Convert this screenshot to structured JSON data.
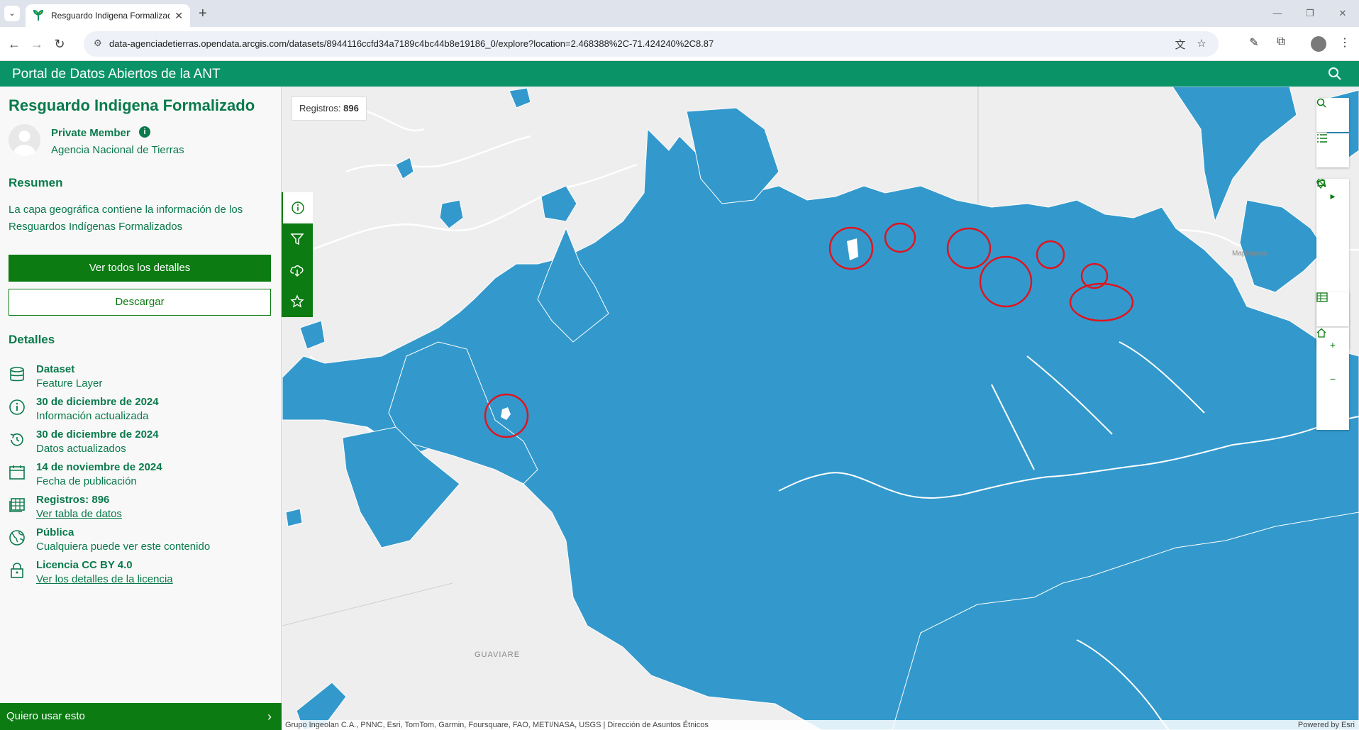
{
  "browser": {
    "tab_title": "Resguardo Indigena Formalizado",
    "url": "data-agenciadetierras.opendata.arcgis.com/datasets/8944116ccfd34a7189c4bc44b8e19186_0/explore?location=2.468388%2C-71.424240%2C8.87"
  },
  "site": {
    "title": "Portal de Datos Abiertos de la ANT",
    "brand_color": "#0a9366"
  },
  "sidebar": {
    "dataset_title": "Resguardo Indigena Formalizado",
    "owner_role": "Private Member",
    "owner_org": "Agencia Nacional de Tierras",
    "summary_heading": "Resumen",
    "summary_text": "La capa geográfica contiene la información de los Resguardos Indígenas Formalizados",
    "details_button": "Ver todos los detalles",
    "download_button": "Descargar",
    "details_heading": "Detalles",
    "details": [
      {
        "icon": "database-icon",
        "strong": "Dataset",
        "sub": "Feature Layer",
        "sub_is_link": false
      },
      {
        "icon": "info-icon",
        "strong": "30 de diciembre de 2024",
        "sub": "Información actualizada",
        "sub_is_link": false
      },
      {
        "icon": "history-icon",
        "strong": "30 de diciembre de 2024",
        "sub": "Datos actualizados",
        "sub_is_link": false
      },
      {
        "icon": "calendar-icon",
        "strong": "14 de noviembre de 2024",
        "sub": "Fecha de publicación",
        "sub_is_link": false
      },
      {
        "icon": "table-icon",
        "strong": "Registros: 896",
        "sub": "Ver tabla de datos",
        "sub_is_link": true
      },
      {
        "icon": "globe-icon",
        "strong": "Pública",
        "sub": "Cualquiera puede ver este contenido",
        "sub_is_link": false
      },
      {
        "icon": "lock-icon",
        "strong": "Licencia CC BY 4.0",
        "sub": "Ver los detalles de la licencia",
        "sub_is_link": true
      }
    ],
    "footer_cta": "Quiero usar esto"
  },
  "map": {
    "records_label": "Registros:",
    "records_count": "896",
    "place_labels": [
      "GUAVIARE",
      "Mapiripana"
    ],
    "attribution": "Grupo Ingeolan C.A., PNNC, Esri, TomTom, Garmin, Foursquare, FAO, METI/NASA, USGS | Dirección de Asuntos Étnicos",
    "powered_by": "Powered by Esri",
    "polygon_color": "#3399cc",
    "annotation_color": "#e0141e"
  }
}
